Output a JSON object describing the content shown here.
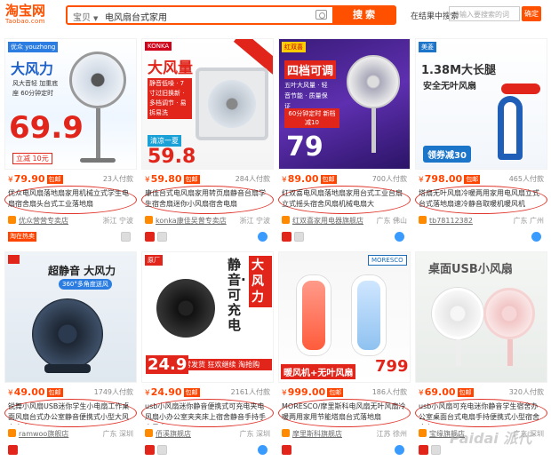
{
  "header": {
    "logo_cn": "淘宝网",
    "logo_en": "Taobao.com",
    "scope": "宝贝",
    "query": "电风扇台式家用",
    "search_label": "搜索",
    "in_results_label": "在结果中搜索",
    "in_results_placeholder": "请输入要搜索的词",
    "confirm_label": "确定"
  },
  "products": [
    {
      "brand": "优众 youzhong",
      "promo": "大风力",
      "promo2": "风大音轻 加重底座 60分钟定时",
      "big_price": "69.9",
      "sub": "立减 10元",
      "price": "79.90",
      "badge": "包邮",
      "paid": "23人付款",
      "title": "优众电风扇落地扇家用机械立式学生电扇宿舍扇头台式工业落地扇",
      "shop": "优众营营专卖店",
      "loc": "浙江 宁波",
      "tag": "淘在热卖"
    },
    {
      "brand": "KONKA",
      "promo": "大风量",
      "promo2": "静音低噪 · 7寸过旧换新 · 多档调节 · 易拆易洗",
      "big_price": "59.8",
      "sub": "清凉一夏",
      "price": "59.80",
      "badge": "包邮",
      "paid": "284人付款",
      "title": "康佳台式电风扇家用转页扇静音台扇学生宿舍扇迷你小风扇宿舍电扇",
      "shop": "konka康佳吴曾专卖店",
      "loc": "浙江 宁波",
      "tag": ""
    },
    {
      "brand": "红双喜",
      "promo": "四档可调",
      "promo2": "五叶大风量 · 轻音节能 · 质量保证",
      "big_price": "79",
      "sub": "60分钟定时 新档减10",
      "price": "89.00",
      "badge": "包邮",
      "paid": "700人付款",
      "title": "红双喜电风扇落地扇家用台式工业台扇立式摇头宿舍风扇机械电扇大",
      "shop": "红双喜家用电器旗舰店",
      "loc": "广东 佛山",
      "tag": ""
    },
    {
      "brand": "美菱",
      "promo": "1.38M大长腿",
      "promo2": "安全无叶风扇",
      "big_price": "",
      "sub": "领券减30",
      "price": "798.00",
      "badge": "包邮",
      "paid": "465人付款",
      "title": "塔扇无叶风扇冷暖两用家用电风扇立式台式落地扇速冷静音取暖机暖风机",
      "shop": "tb78112382",
      "loc": "广东 广州",
      "tag": ""
    },
    {
      "brand": "",
      "promo": "超静音 大风力",
      "promo2": "360°多角度送风",
      "big_price": "",
      "sub": "",
      "price": "49.00",
      "badge": "包邮",
      "paid": "1749人付款",
      "title": "锐舞小风扇USB迷你学生小电扇工作桌面风扇台式办公室静音便携式小型大风力电扇",
      "shop": "ramwoo旗舰店",
      "loc": "广东 深圳",
      "tag": ""
    },
    {
      "brand": "原厂",
      "promo": "静音·可充电",
      "promo2": "大风力",
      "big_price": "24.9",
      "sub": "正常发货 狂欢继续 淘抢购",
      "price": "24.90",
      "badge": "包邮",
      "paid": "2161人付款",
      "title": "usb小风扇迷你静音便携式可充电夹电风扇小办公室夹夹床上宿舍静音手持手电风扇",
      "shop": "佰溪旗舰店",
      "loc": "广东 深圳",
      "tag": ""
    },
    {
      "brand": "MORESCO",
      "promo": "暖风机+无叶风扇",
      "promo2": "",
      "big_price": "799",
      "sub": "",
      "price": "999.00",
      "badge": "包邮",
      "paid": "186人付款",
      "title": "MORESCO/摩里斯科电风扇无叶风扇冷暖两用家用节能塔扇台式落地扇",
      "shop": "摩里斯科旗舰店",
      "loc": "江苏 徐州",
      "tag": ""
    },
    {
      "brand": "",
      "promo": "桌面USB小风扇",
      "promo2": "",
      "big_price": "",
      "sub": "",
      "price": "69.00",
      "badge": "包邮",
      "paid": "320人付款",
      "title": "usb小风扇可充电迷你静音学生宿舍办公室桌面台式电扇手持便携式小型宿舍床上",
      "shop": "宝缘旗舰店",
      "loc": "广东 深圳",
      "tag": ""
    }
  ],
  "watermark": "Paidai 派代",
  "colors": {
    "accent": "#ff5000",
    "price": "#ff4400",
    "annotation": "#e0352b"
  }
}
